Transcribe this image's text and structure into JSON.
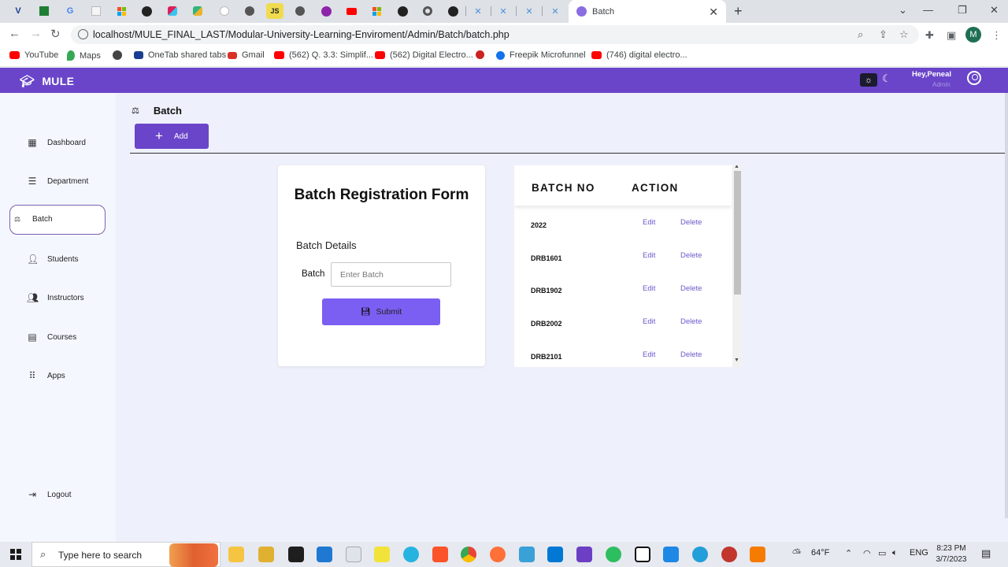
{
  "browser": {
    "active_tab_title": "Batch",
    "url": "localhost/MULE_FINAL_LAST/Modular-University-Learning-Enviroment/Admin/Batch/batch.php",
    "profile_initial": "M",
    "bookmarks": [
      {
        "label": "YouTube",
        "color": "#ff0000"
      },
      {
        "label": "Maps",
        "color": "#34a853"
      },
      {
        "label": "",
        "color": "#444444"
      },
      {
        "label": "OneTab shared tabs",
        "color": "#1a3d8f"
      },
      {
        "label": "Gmail",
        "color": "#d93025"
      },
      {
        "label": "(562) Q. 3.3: Simplif...",
        "color": "#ff0000"
      },
      {
        "label": "(562) Digital Electro...",
        "color": "#ff0000"
      },
      {
        "label": "",
        "color": "#cc2222"
      },
      {
        "label": "Freepik Microfunnel",
        "color": "#1273eb"
      },
      {
        "label": "(746) digital electro...",
        "color": "#ff0000"
      }
    ]
  },
  "app": {
    "brand": "MULE",
    "greeting": "Hey,Peneal",
    "role": "Admin",
    "accent": "#6a45c9"
  },
  "sidebar": {
    "items": [
      {
        "label": "Dashboard",
        "icon": "dashboard-icon"
      },
      {
        "label": "Department",
        "icon": "table-icon"
      },
      {
        "label": "Batch",
        "icon": "batch-icon"
      },
      {
        "label": "Students",
        "icon": "students-icon"
      },
      {
        "label": "Instructors",
        "icon": "instructors-icon"
      },
      {
        "label": "Courses",
        "icon": "courses-icon"
      },
      {
        "label": "Apps",
        "icon": "apps-icon"
      }
    ],
    "logout": "Logout"
  },
  "page": {
    "title": "Batch",
    "add_label": "Add"
  },
  "form": {
    "title": "Batch Registration Form",
    "section": "Batch Details",
    "field_label": "Batch",
    "field_placeholder": "Enter Batch",
    "submit_label": "Submit"
  },
  "table": {
    "headers": [
      "BATCH NO",
      "ACTION"
    ],
    "rows": [
      {
        "no": "2022",
        "edit": "Edit",
        "delete": "Delete"
      },
      {
        "no": "DRB1601",
        "edit": "Edit",
        "delete": "Delete"
      },
      {
        "no": "DRB1902",
        "edit": "Edit",
        "delete": "Delete"
      },
      {
        "no": "DRB2002",
        "edit": "Edit",
        "delete": "Delete"
      },
      {
        "no": "DRB2101",
        "edit": "Edit",
        "delete": "Delete"
      }
    ]
  },
  "taskbar": {
    "search_placeholder": "Type here to search",
    "temperature": "64°F",
    "language": "ENG",
    "time": "8:23 PM",
    "date": "3/7/2023"
  }
}
